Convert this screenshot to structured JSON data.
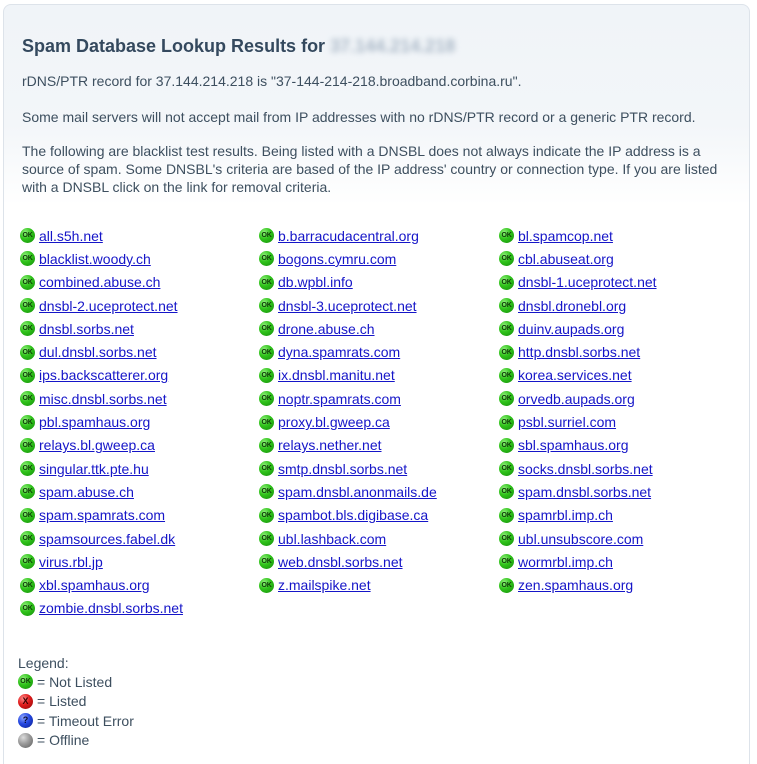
{
  "header": {
    "title": "Spam Database Lookup Results for",
    "ip_obscured": "37.144.214.218"
  },
  "paragraphs": {
    "rdns": "rDNS/PTR record for 37.144.214.218 is \"37-144-214-218.broadband.corbina.ru\".",
    "ptr_note": "Some mail servers will not accept mail from IP addresses with no rDNS/PTR record or a generic PTR record.",
    "blacklist_note": "The following are blacklist test results. Being listed with a DNSBL does not always indicate the IP address is a source of spam. Some DNSBL's criteria are based of the IP address' country or connection type. If you are listed with a DNSBL click on the link for removal criteria."
  },
  "status_icon_text": "OK",
  "results": {
    "column1": [
      {
        "name": "all.s5h.net",
        "status": "not-listed"
      },
      {
        "name": "blacklist.woody.ch",
        "status": "not-listed"
      },
      {
        "name": "combined.abuse.ch",
        "status": "not-listed"
      },
      {
        "name": "dnsbl-2.uceprotect.net",
        "status": "not-listed"
      },
      {
        "name": "dnsbl.sorbs.net",
        "status": "not-listed"
      },
      {
        "name": "dul.dnsbl.sorbs.net",
        "status": "not-listed"
      },
      {
        "name": "ips.backscatterer.org",
        "status": "not-listed"
      },
      {
        "name": "misc.dnsbl.sorbs.net",
        "status": "not-listed"
      },
      {
        "name": "pbl.spamhaus.org",
        "status": "not-listed"
      },
      {
        "name": "relays.bl.gweep.ca",
        "status": "not-listed"
      },
      {
        "name": "singular.ttk.pte.hu",
        "status": "not-listed"
      },
      {
        "name": "spam.abuse.ch",
        "status": "not-listed"
      },
      {
        "name": "spam.spamrats.com",
        "status": "not-listed"
      },
      {
        "name": "spamsources.fabel.dk",
        "status": "not-listed"
      },
      {
        "name": "virus.rbl.jp",
        "status": "not-listed"
      },
      {
        "name": "xbl.spamhaus.org",
        "status": "not-listed"
      },
      {
        "name": "zombie.dnsbl.sorbs.net",
        "status": "not-listed"
      }
    ],
    "column2": [
      {
        "name": "b.barracudacentral.org",
        "status": "not-listed"
      },
      {
        "name": "bogons.cymru.com",
        "status": "not-listed"
      },
      {
        "name": "db.wpbl.info",
        "status": "not-listed"
      },
      {
        "name": "dnsbl-3.uceprotect.net",
        "status": "not-listed"
      },
      {
        "name": "drone.abuse.ch",
        "status": "not-listed"
      },
      {
        "name": "dyna.spamrats.com",
        "status": "not-listed"
      },
      {
        "name": "ix.dnsbl.manitu.net",
        "status": "not-listed"
      },
      {
        "name": "noptr.spamrats.com",
        "status": "not-listed"
      },
      {
        "name": "proxy.bl.gweep.ca",
        "status": "not-listed"
      },
      {
        "name": "relays.nether.net",
        "status": "not-listed"
      },
      {
        "name": "smtp.dnsbl.sorbs.net",
        "status": "not-listed"
      },
      {
        "name": "spam.dnsbl.anonmails.de",
        "status": "not-listed"
      },
      {
        "name": "spambot.bls.digibase.ca",
        "status": "not-listed"
      },
      {
        "name": "ubl.lashback.com",
        "status": "not-listed"
      },
      {
        "name": "web.dnsbl.sorbs.net",
        "status": "not-listed"
      },
      {
        "name": "z.mailspike.net",
        "status": "not-listed"
      }
    ],
    "column3": [
      {
        "name": "bl.spamcop.net",
        "status": "not-listed"
      },
      {
        "name": "cbl.abuseat.org",
        "status": "not-listed"
      },
      {
        "name": "dnsbl-1.uceprotect.net",
        "status": "not-listed"
      },
      {
        "name": "dnsbl.dronebl.org",
        "status": "not-listed"
      },
      {
        "name": "duinv.aupads.org",
        "status": "not-listed"
      },
      {
        "name": "http.dnsbl.sorbs.net",
        "status": "not-listed"
      },
      {
        "name": "korea.services.net",
        "status": "not-listed"
      },
      {
        "name": "orvedb.aupads.org",
        "status": "not-listed"
      },
      {
        "name": "psbl.surriel.com",
        "status": "not-listed"
      },
      {
        "name": "sbl.spamhaus.org",
        "status": "not-listed"
      },
      {
        "name": "socks.dnsbl.sorbs.net",
        "status": "not-listed"
      },
      {
        "name": "spam.dnsbl.sorbs.net",
        "status": "not-listed"
      },
      {
        "name": "spamrbl.imp.ch",
        "status": "not-listed"
      },
      {
        "name": "ubl.unsubscore.com",
        "status": "not-listed"
      },
      {
        "name": "wormrbl.imp.ch",
        "status": "not-listed"
      },
      {
        "name": "zen.spamhaus.org",
        "status": "not-listed"
      }
    ]
  },
  "legend": {
    "title": "Legend:",
    "items": [
      {
        "icon": "ok-icon",
        "glyph": "OK",
        "label": "= Not Listed",
        "color": "#2fc21a"
      },
      {
        "icon": "x-icon",
        "glyph": "X",
        "label": "= Listed",
        "color": "#e01b1b"
      },
      {
        "icon": "question-icon",
        "glyph": "?",
        "label": "= Timeout Error",
        "color": "#2346e0"
      },
      {
        "icon": "gray-circle-icon",
        "glyph": "",
        "label": "= Offline",
        "color": "#9a9a9a"
      }
    ]
  }
}
